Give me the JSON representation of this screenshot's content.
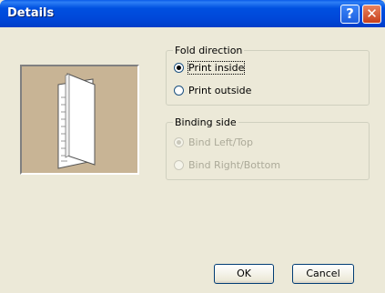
{
  "window": {
    "title": "Details",
    "help_icon": "?",
    "close_icon": "✕"
  },
  "fold_direction": {
    "legend": "Fold direction",
    "options": [
      {
        "label": "Print inside",
        "selected": true
      },
      {
        "label": "Print outside",
        "selected": false
      }
    ]
  },
  "binding_side": {
    "legend": "Binding side",
    "options": [
      {
        "label": "Bind Left/Top",
        "selected": true,
        "disabled": true
      },
      {
        "label": "Bind Right/Bottom",
        "selected": false,
        "disabled": true
      }
    ]
  },
  "buttons": {
    "ok": "OK",
    "cancel": "Cancel"
  },
  "colors": {
    "titlebar": "#0054e3",
    "preview_bg": "#c8b495",
    "dialog_bg": "#ece9d8"
  }
}
